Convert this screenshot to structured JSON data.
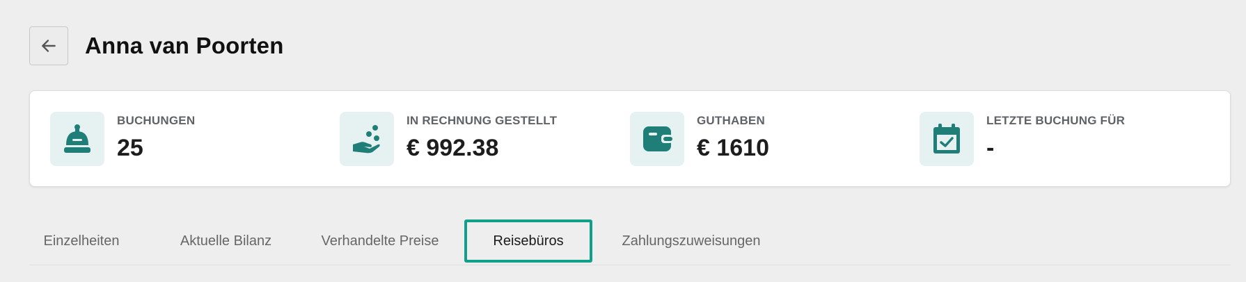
{
  "header": {
    "title": "Anna van Poorten",
    "back_icon": "arrow-left-icon"
  },
  "colors": {
    "accent": "#10a08a",
    "icon_teal": "#1f7f78",
    "icon_bg": "#e6f2f1",
    "background": "#eeeeee"
  },
  "stats": [
    {
      "label": "BUCHUNGEN",
      "value": "25",
      "icon": "service-bell-icon"
    },
    {
      "label": "IN RECHNUNG GESTELLT",
      "value": "€ 992.38",
      "icon": "hand-coins-icon"
    },
    {
      "label": "GUTHABEN",
      "value": "€ 1610",
      "icon": "wallet-icon"
    },
    {
      "label": "LETZTE BUCHUNG FÜR",
      "value": "-",
      "icon": "calendar-check-icon"
    }
  ],
  "tabs": [
    {
      "label": "Einzelheiten",
      "active": false
    },
    {
      "label": "Aktuelle Bilanz",
      "active": false
    },
    {
      "label": "Verhandelte Preise",
      "active": false
    },
    {
      "label": "Reisebüros",
      "active": true
    },
    {
      "label": "Zahlungszuweisungen",
      "active": false
    }
  ]
}
